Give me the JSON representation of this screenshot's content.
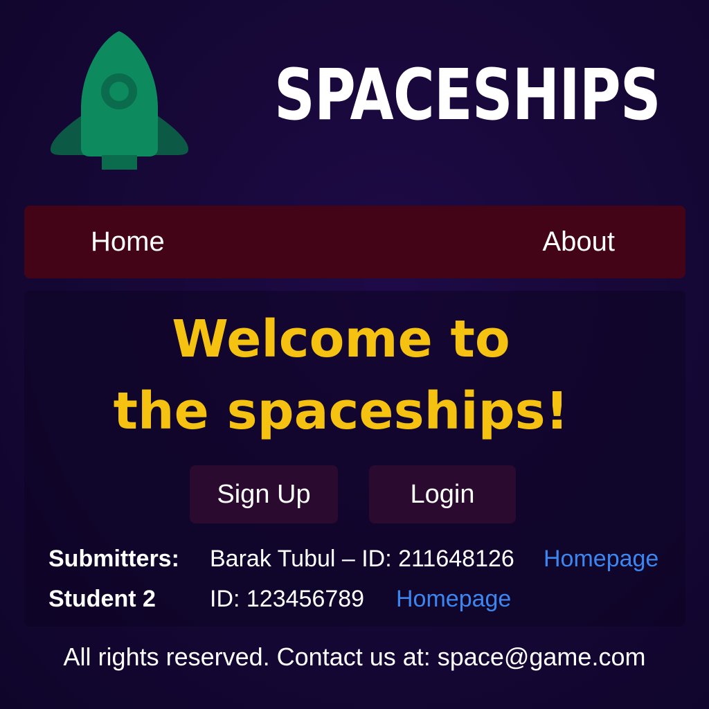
{
  "header": {
    "logo_icon": "rocket-icon",
    "logo_color": "#0e8a5f",
    "title": "SPACESHIPS"
  },
  "nav": {
    "background": "#430417",
    "items": [
      {
        "label": "Home"
      },
      {
        "label": "About"
      }
    ]
  },
  "main": {
    "welcome_line1": "Welcome to",
    "welcome_line2": "the spaceships!",
    "welcome_color": "#f5c211",
    "buttons": {
      "signup": "Sign Up",
      "login": "Login"
    }
  },
  "submitters": {
    "label1": "Submitters:",
    "text1": "Barak Tubul – ID: 211648126",
    "link1": "Homepage",
    "label2": "Student 2",
    "text2": "ID: 123456789",
    "link2": "Homepage",
    "link_color": "#3d86f0"
  },
  "footer": {
    "text": "All rights reserved. Contact us at: space@game.com"
  }
}
